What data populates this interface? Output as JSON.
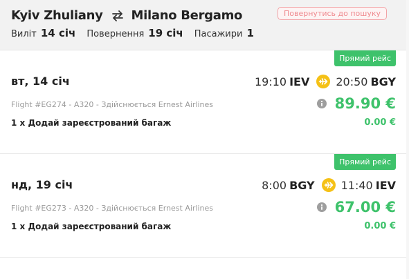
{
  "header": {
    "origin": "Kyiv Zhuliany",
    "destination": "Milano Bergamo",
    "departure_label": "Виліт",
    "departure_date": "14 січ",
    "return_label": "Повернення",
    "return_date": "19 січ",
    "passengers_label": "Пасажири",
    "passengers_count": "1",
    "back_button_label": "Повернутись до пошуку"
  },
  "colors": {
    "accent_green": "#3ec26b",
    "plane_yellow": "#f5c116",
    "back_button_red": "#ef8a8f"
  },
  "flights": [
    {
      "badge": "Прямий рейс",
      "date": "вт, 14 січ",
      "dep_time": "19:10",
      "dep_code": "IEV",
      "arr_time": "20:50",
      "arr_code": "BGY",
      "info": "Flight #EG274 - A320 - Здійснюється Ernest Airlines",
      "price": "89.90 €",
      "baggage_label": "1 x Додай зареєстрований багаж",
      "baggage_price": "0.00 €"
    },
    {
      "badge": "Прямий рейс",
      "date": "нд, 19 січ",
      "dep_time": "8:00",
      "dep_code": "BGY",
      "arr_time": "11:40",
      "arr_code": "IEV",
      "info": "Flight #EG273 - A320 - Здійснюється Ernest Airlines",
      "price": "67.00 €",
      "baggage_label": "1 x Додай зареєстрований багаж",
      "baggage_price": "0.00 €"
    }
  ]
}
